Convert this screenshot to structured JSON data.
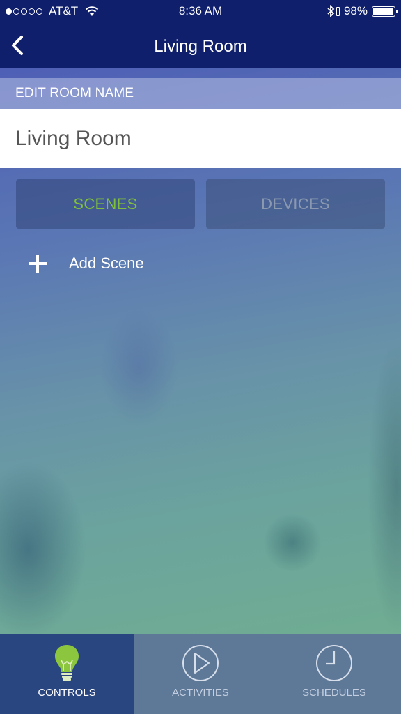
{
  "status_bar": {
    "signal_bars_total": 5,
    "signal_bars_filled": 1,
    "carrier": "AT&T",
    "wifi_icon": "wifi-icon",
    "time": "8:36 AM",
    "bluetooth_icon": "bluetooth-icon",
    "battery_percent_label": "98%",
    "battery_level": 0.98
  },
  "nav": {
    "back_icon": "chevron-left-icon",
    "title": "Living Room"
  },
  "edit_room": {
    "section_label": "EDIT ROOM NAME",
    "name_value": "Living Room"
  },
  "segments": {
    "scenes_label": "SCENES",
    "devices_label": "DEVICES",
    "selected": "SCENES",
    "active_color": "#7fbf3b"
  },
  "scenes": {
    "add_label": "Add Scene",
    "add_icon": "plus-icon"
  },
  "tabbar": {
    "tabs": [
      {
        "label": "CONTROLS",
        "icon": "lightbulb-icon",
        "active": true
      },
      {
        "label": "ACTIVITIES",
        "icon": "play-circle-icon",
        "active": false
      },
      {
        "label": "SCHEDULES",
        "icon": "clock-icon",
        "active": false
      }
    ]
  }
}
